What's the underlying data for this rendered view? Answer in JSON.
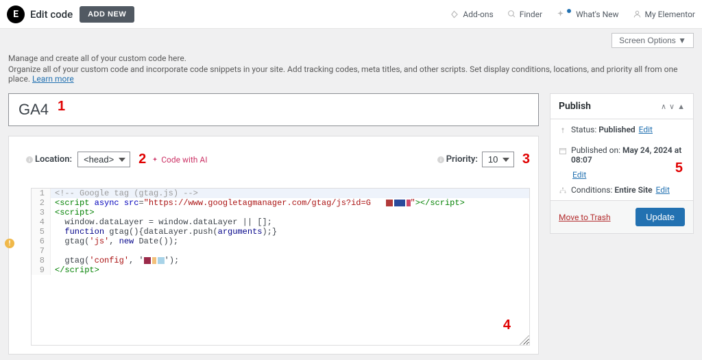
{
  "topbar": {
    "page_title": "Edit code",
    "add_new": "ADD NEW",
    "addons": "Add-ons",
    "finder": "Finder",
    "whats_new": "What's New",
    "my_elementor": "My Elementor"
  },
  "screen_options": "Screen Options  ▼",
  "intro": {
    "line1": "Manage and create all of your custom code here.",
    "line2": "Organize all of your custom code and incorporate code snippets in your site. Add tracking codes, meta titles, and other scripts. Set display conditions, locations, and priority all from one place. ",
    "learn_more": "Learn more"
  },
  "editor": {
    "title_value": "GA4",
    "location_label": "Location:",
    "location_value": "<head>",
    "code_with_ai": "Code with AI",
    "priority_label": "Priority:",
    "priority_value": "10"
  },
  "code": {
    "l1": "<!-- Google tag (gtag.js) -->",
    "l2a": "<",
    "l2b": "script",
    "l2c": " async",
    "l2d": " src",
    "l2e": "=",
    "l2f": "\"https://www.googletagmanager.com/gtag/js?id=G",
    "l2g": "\"",
    "l2h": "></",
    "l2i": "script",
    "l2j": ">",
    "l3a": "<",
    "l3b": "script",
    "l3c": ">",
    "l4": "  window.dataLayer = window.dataLayer || [];",
    "l5a": "  ",
    "l5b": "function",
    "l5c": " gtag(){dataLayer.push(",
    "l5d": "arguments",
    "l5e": ");}",
    "l6a": "  gtag(",
    "l6b": "'js'",
    "l6c": ", ",
    "l6d": "new",
    "l6e": " Date());",
    "l8a": "  gtag(",
    "l8b": "'config'",
    "l8c": ", '",
    "l8d": "');",
    "l9a": "</",
    "l9b": "script",
    "l9c": ">"
  },
  "publish": {
    "title": "Publish",
    "status_label": "Status: ",
    "status_value": "Published",
    "published_on_label": "Published on: ",
    "published_on_value": "May 24, 2024 at 08:07",
    "conditions_label": "Conditions: ",
    "conditions_value": "Entire Site",
    "edit": "Edit",
    "trash": "Move to Trash",
    "update": "Update"
  },
  "annotations": {
    "a1": "1",
    "a2": "2",
    "a3": "3",
    "a4": "4",
    "a5": "5"
  }
}
